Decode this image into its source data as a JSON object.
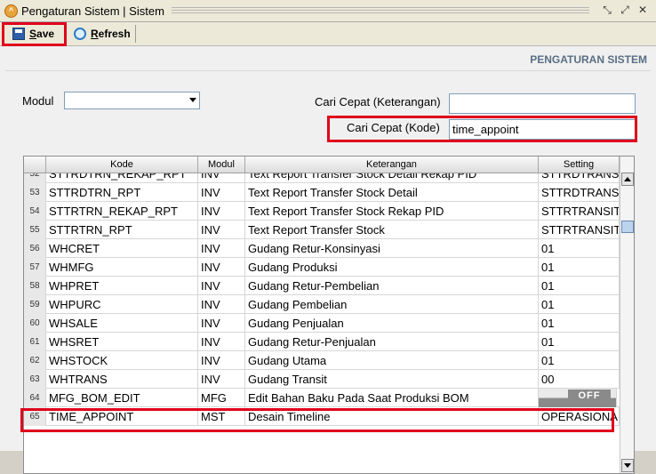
{
  "window": {
    "title": "Pengaturan Sistem | Sistem"
  },
  "toolbar": {
    "save_label": "Save",
    "refresh_label": "Refresh"
  },
  "panel": {
    "section_title": "PENGATURAN SISTEM"
  },
  "filters": {
    "modul_label": "Modul",
    "modul_value": "",
    "cari_keterangan_label": "Cari Cepat (Keterangan)",
    "cari_keterangan_value": "",
    "cari_kode_label": "Cari Cepat (Kode)",
    "cari_kode_value": "time_appoint"
  },
  "table": {
    "columns": [
      "Kode",
      "Modul",
      "Keterangan",
      "Setting"
    ],
    "rows": [
      {
        "no": "52",
        "kode": "STTRDTRN_REKAP_RPT",
        "modul": "INV",
        "keterangan": "Text Report Transfer Stock Detail Rekap PID",
        "setting": "STTRDTRANSIT_RK"
      },
      {
        "no": "53",
        "kode": "STTRDTRN_RPT",
        "modul": "INV",
        "keterangan": "Text Report Transfer Stock Detail",
        "setting": "STTRDTRANSIT"
      },
      {
        "no": "54",
        "kode": "STTRTRN_REKAP_RPT",
        "modul": "INV",
        "keterangan": "Text Report Transfer Stock Rekap PID",
        "setting": "STTRTRANSIT_RK"
      },
      {
        "no": "55",
        "kode": "STTRTRN_RPT",
        "modul": "INV",
        "keterangan": "Text Report Transfer Stock",
        "setting": "STTRTRANSIT"
      },
      {
        "no": "56",
        "kode": "WHCRET",
        "modul": "INV",
        "keterangan": "Gudang Retur-Konsinyasi",
        "setting": "01"
      },
      {
        "no": "57",
        "kode": "WHMFG",
        "modul": "INV",
        "keterangan": "Gudang Produksi",
        "setting": "01"
      },
      {
        "no": "58",
        "kode": "WHPRET",
        "modul": "INV",
        "keterangan": "Gudang Retur-Pembelian",
        "setting": "01"
      },
      {
        "no": "59",
        "kode": "WHPURC",
        "modul": "INV",
        "keterangan": "Gudang Pembelian",
        "setting": "01"
      },
      {
        "no": "60",
        "kode": "WHSALE",
        "modul": "INV",
        "keterangan": "Gudang Penjualan",
        "setting": "01"
      },
      {
        "no": "61",
        "kode": "WHSRET",
        "modul": "INV",
        "keterangan": "Gudang Retur-Penjualan",
        "setting": "01"
      },
      {
        "no": "62",
        "kode": "WHSTOCK",
        "modul": "INV",
        "keterangan": "Gudang Utama",
        "setting": "01"
      },
      {
        "no": "63",
        "kode": "WHTRANS",
        "modul": "INV",
        "keterangan": "Gudang Transit",
        "setting": "00"
      },
      {
        "no": "64",
        "kode": "MFG_BOM_EDIT",
        "modul": "MFG",
        "keterangan": "Edit Bahan Baku Pada Saat Produksi BOM",
        "setting": "OFF"
      },
      {
        "no": "65",
        "kode": "TIME_APPOINT",
        "modul": "MST",
        "keterangan": "Desain Timeline",
        "setting": "OPERASIONAL"
      }
    ]
  },
  "colors": {
    "highlight": "#e0001b"
  }
}
